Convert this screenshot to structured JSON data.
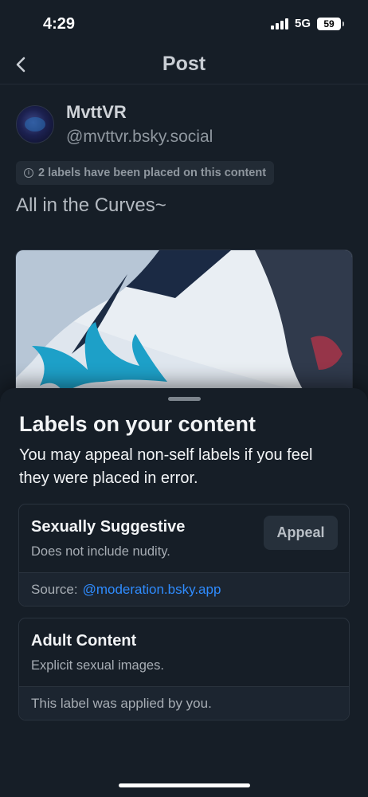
{
  "status_bar": {
    "time": "4:29",
    "network": "5G",
    "battery": "59"
  },
  "nav": {
    "title": "Post",
    "back_icon": "chevron-left-icon"
  },
  "post": {
    "author": {
      "display_name": "MvttVR",
      "handle": "@mvttvr.bsky.social"
    },
    "labels_notice": "2 labels have been placed on this content",
    "text": "All in the Curves~"
  },
  "sheet": {
    "title": "Labels on your content",
    "description": "You may appeal non-self labels if you feel they were placed in error.",
    "labels": [
      {
        "name": "Sexually Suggestive",
        "description": "Does not include nudity.",
        "appeal_label": "Appeal",
        "source_prefix": "Source:",
        "source_link": "@moderation.bsky.app"
      },
      {
        "name": "Adult Content",
        "description": "Explicit sexual images.",
        "footer": "This label was applied by you."
      }
    ]
  },
  "colors": {
    "background": "#161e27",
    "accent_link": "#2f8cff",
    "card_footer": "#1c2530"
  }
}
